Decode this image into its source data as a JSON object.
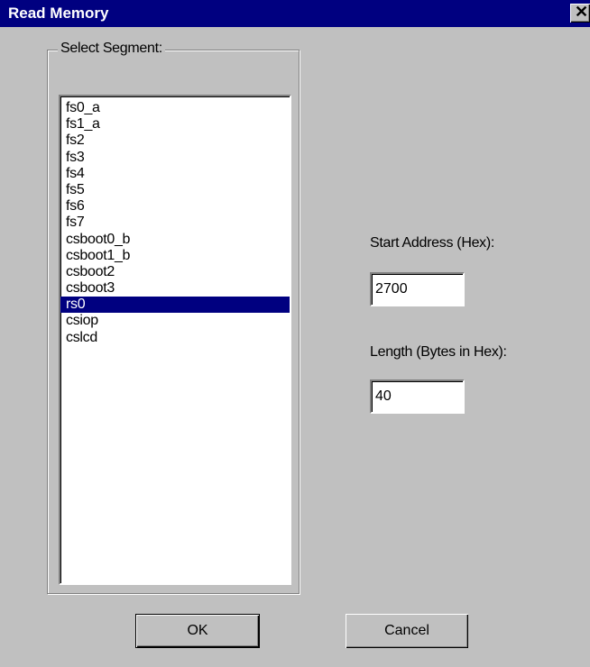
{
  "window": {
    "title": "Read Memory",
    "close_glyph": "✕"
  },
  "segment_group": {
    "label": "Select Segment:",
    "items": [
      {
        "label": "fs0_a",
        "selected": false
      },
      {
        "label": "fs1_a",
        "selected": false
      },
      {
        "label": "fs2",
        "selected": false
      },
      {
        "label": "fs3",
        "selected": false
      },
      {
        "label": "fs4",
        "selected": false
      },
      {
        "label": "fs5",
        "selected": false
      },
      {
        "label": "fs6",
        "selected": false
      },
      {
        "label": "fs7",
        "selected": false
      },
      {
        "label": "csboot0_b",
        "selected": false
      },
      {
        "label": "csboot1_b",
        "selected": false
      },
      {
        "label": "csboot2",
        "selected": false
      },
      {
        "label": "csboot3",
        "selected": false
      },
      {
        "label": "rs0",
        "selected": true
      },
      {
        "label": "csiop",
        "selected": false
      },
      {
        "label": "cslcd",
        "selected": false
      }
    ]
  },
  "start_address": {
    "label": "Start Address (Hex):",
    "value": "2700"
  },
  "length": {
    "label": "Length (Bytes in Hex):",
    "value": "40"
  },
  "buttons": {
    "ok": "OK",
    "cancel": "Cancel"
  },
  "colors": {
    "dialog_bg": "#c0c0c0",
    "titlebar": "#000080",
    "selection": "#000080"
  }
}
